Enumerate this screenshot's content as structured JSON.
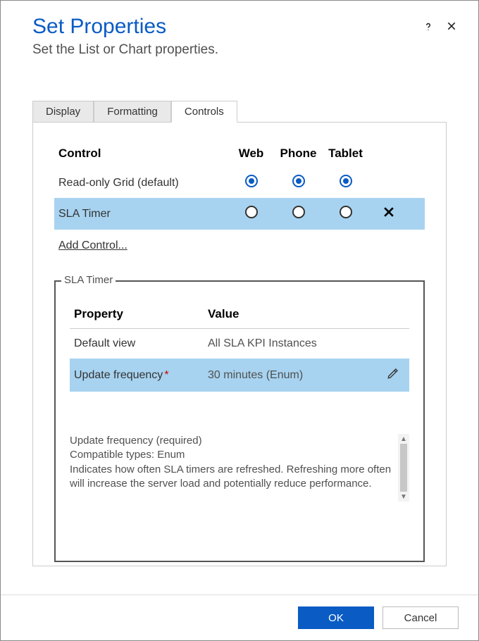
{
  "header": {
    "title": "Set Properties",
    "subtitle": "Set the List or Chart properties."
  },
  "tabs": {
    "display": "Display",
    "formatting": "Formatting",
    "controls": "Controls"
  },
  "controls": {
    "col_control": "Control",
    "col_web": "Web",
    "col_phone": "Phone",
    "col_tablet": "Tablet",
    "rows": [
      {
        "label": "Read-only Grid (default)",
        "web": true,
        "phone": true,
        "tablet": true,
        "removable": false,
        "selected": false
      },
      {
        "label": "SLA Timer",
        "web": false,
        "phone": false,
        "tablet": false,
        "removable": true,
        "selected": true
      }
    ],
    "add_control": "Add Control..."
  },
  "fieldset": {
    "legend": "SLA Timer",
    "col_property": "Property",
    "col_value": "Value",
    "properties": [
      {
        "name": "Default view",
        "value": "All SLA KPI Instances",
        "required": false,
        "selected": false
      },
      {
        "name": "Update frequency",
        "value": "30 minutes (Enum)",
        "required": true,
        "selected": true
      }
    ],
    "description": {
      "line1": "Update frequency (required)",
      "line2": "Compatible types: Enum",
      "line3": "Indicates how often SLA timers are refreshed. Refreshing more often will increase the server load and potentially reduce performance."
    }
  },
  "footer": {
    "ok": "OK",
    "cancel": "Cancel"
  }
}
